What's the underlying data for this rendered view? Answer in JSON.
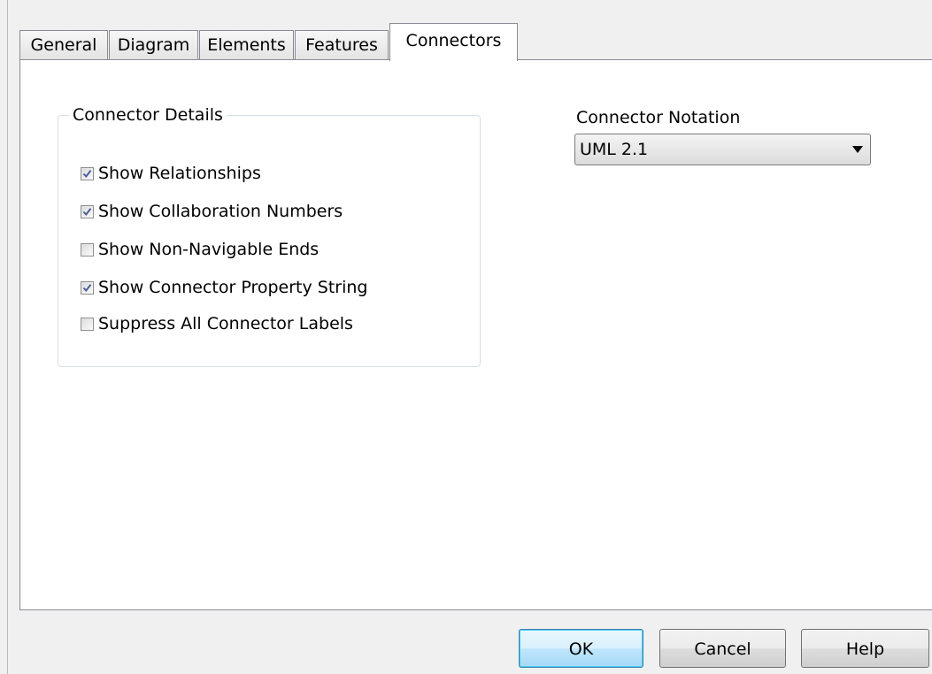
{
  "tabs": [
    {
      "label": "General",
      "active": false
    },
    {
      "label": "Diagram",
      "active": false
    },
    {
      "label": "Elements",
      "active": false
    },
    {
      "label": "Features",
      "active": false
    },
    {
      "label": "Connectors",
      "active": true
    }
  ],
  "connector_details": {
    "title": "Connector Details",
    "options": [
      {
        "label": "Show Relationships",
        "checked": true
      },
      {
        "label": "Show Collaboration Numbers",
        "checked": true
      },
      {
        "label": "Show Non-Navigable Ends",
        "checked": false
      },
      {
        "label": "Show Connector Property String",
        "checked": true
      },
      {
        "label": "Suppress All Connector Labels",
        "checked": false
      }
    ]
  },
  "connector_notation": {
    "label": "Connector Notation",
    "selected": "UML 2.1"
  },
  "buttons": {
    "ok": "OK",
    "cancel": "Cancel",
    "help": "Help"
  },
  "colors": {
    "checkmark": "#4a5f97",
    "default_button_border": "#3c7fb1"
  }
}
